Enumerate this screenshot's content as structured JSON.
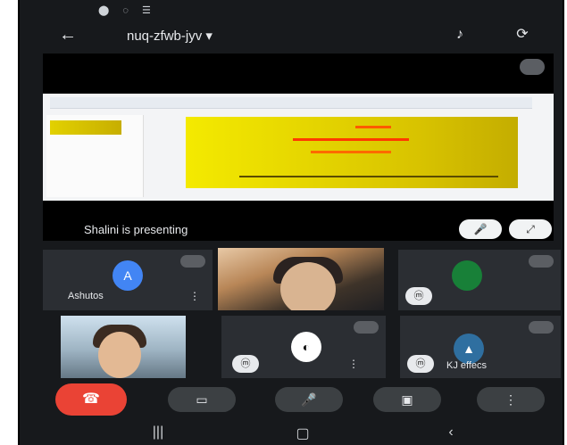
{
  "status_bar": {
    "time": "",
    "right": ""
  },
  "header": {
    "meeting_code": "nuq-zfwb-jyv",
    "dropdown_icon": "▾",
    "back_icon": "arrow-left-icon",
    "icons": [
      "speaker-icon",
      "switch-camera-icon"
    ]
  },
  "presentation": {
    "label": "Shalini is presenting"
  },
  "tiles": [
    {
      "id": "avatar-a",
      "initial": "A",
      "name": "Ashutos",
      "color": "#4285f4"
    },
    {
      "id": "video-1",
      "name": ""
    },
    {
      "id": "avatar-b",
      "initial": "",
      "name": "",
      "color": "#188038"
    },
    {
      "id": "video-2",
      "name": ""
    },
    {
      "id": "tile-5",
      "name": ""
    },
    {
      "id": "tile-6",
      "name": "KJ effecs"
    }
  ],
  "controls": [
    "hangup-icon",
    "video-icon",
    "mic-icon",
    "present-icon",
    "more-icon"
  ],
  "system_nav": [
    "recents-icon",
    "home-icon",
    "back-icon"
  ]
}
